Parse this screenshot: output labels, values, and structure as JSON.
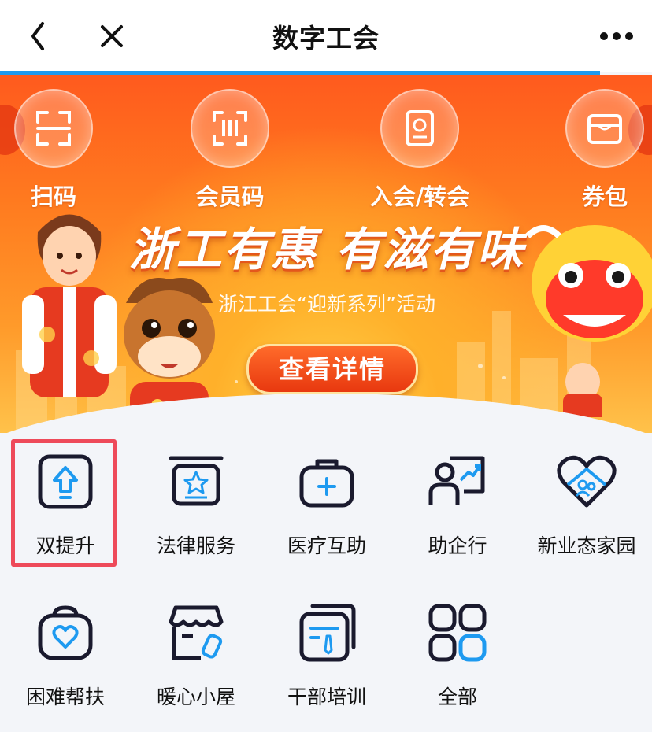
{
  "nav": {
    "title": "数字工会",
    "back_icon": "chevron-left-icon",
    "close_icon": "close-icon",
    "more_icon": "more-horizontal-icon",
    "load_progress": 0.92
  },
  "banner": {
    "quick_actions": [
      {
        "label": "扫码",
        "icon": "scan-icon"
      },
      {
        "label": "会员码",
        "icon": "member-code-icon"
      },
      {
        "label": "入会/转会",
        "icon": "membership-card-icon"
      },
      {
        "label": "券包",
        "icon": "coupon-wallet-icon"
      }
    ],
    "title": "浙工有惠 有滋有味",
    "subtitle": "浙江工会“迎新系列”活动",
    "cta_label": "查看详情"
  },
  "services": [
    {
      "label": "双提升",
      "icon": "upgrade-arrow-icon",
      "highlighted": true
    },
    {
      "label": "法律服务",
      "icon": "legal-badge-icon"
    },
    {
      "label": "医疗互助",
      "icon": "medical-kit-icon"
    },
    {
      "label": "助企行",
      "icon": "presentation-growth-icon"
    },
    {
      "label": "新业态家园",
      "icon": "heart-home-icon"
    },
    {
      "label": "困难帮扶",
      "icon": "heart-bag-icon"
    },
    {
      "label": "暖心小屋",
      "icon": "cozy-shop-icon"
    },
    {
      "label": "干部培训",
      "icon": "training-document-icon"
    },
    {
      "label": "全部",
      "icon": "all-apps-grid-icon"
    }
  ],
  "colors": {
    "accent": "#1e9af0",
    "highlight_border": "#ee4a5a",
    "banner_orange": "#ff7a1f",
    "icon_stroke": "#1a1a2e"
  }
}
